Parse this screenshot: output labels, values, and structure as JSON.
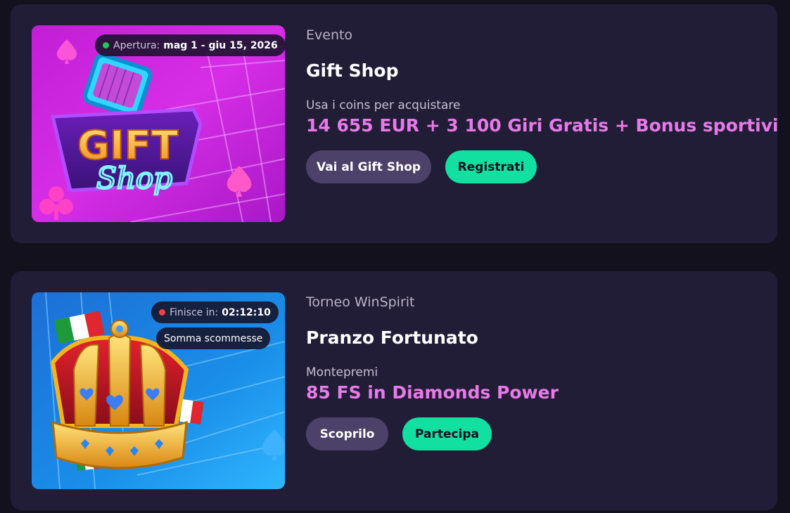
{
  "colors": {
    "page_bg": "#14111f",
    "card_bg": "#221d36",
    "accent_pink": "#e77ae8",
    "accent_green": "#12e0a0",
    "secondary_btn": "#4c4168",
    "status_open": "#22c55e",
    "status_ending": "#ef4444"
  },
  "cards": [
    {
      "image_alt": "Gift Shop",
      "status": {
        "label": "Apertura:",
        "value": "mag 1 - giu 15, 2026",
        "dot_color": "#22c55e"
      },
      "eyebrow": "Evento",
      "title": "Gift Shop",
      "subtitle": "Usa i coins per acquistare",
      "prize": "14 655 EUR + 3 100 Giri Gratis + Bonus sportivi",
      "buttons": {
        "secondary": "Vai al Gift Shop",
        "primary": "Registrati"
      },
      "logo_text": {
        "line1": "GIFT",
        "line2": "Shop"
      }
    },
    {
      "image_alt": "Pranzo Fortunato",
      "status": {
        "label": "Finisce in:",
        "value": "02:12:10",
        "dot_color": "#ef4444"
      },
      "tag": "Somma scommesse",
      "eyebrow": "Torneo WinSpirit",
      "title": "Pranzo Fortunato",
      "subtitle": "Montepremi",
      "prize": "85 FS in Diamonds Power",
      "buttons": {
        "secondary": "Scoprilo",
        "primary": "Partecipa"
      }
    }
  ]
}
